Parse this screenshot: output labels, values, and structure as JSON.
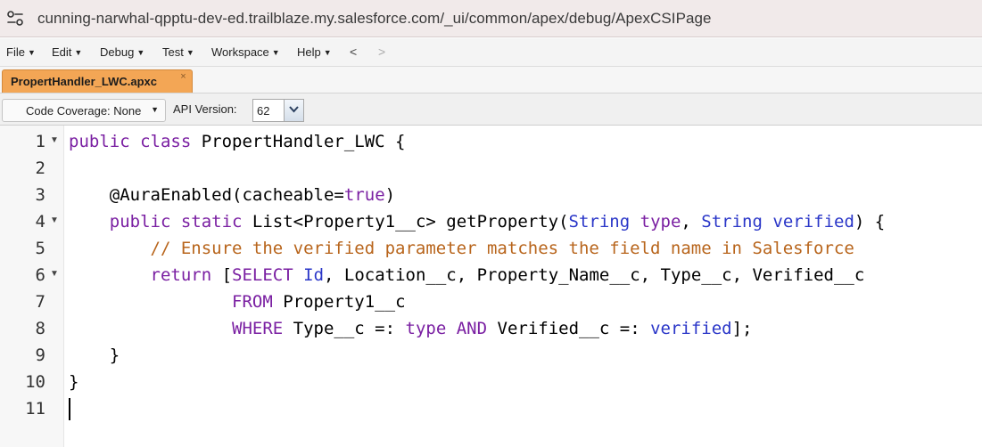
{
  "browser": {
    "url": "cunning-narwhal-qpptu-dev-ed.trailblaze.my.salesforce.com/_ui/common/apex/debug/ApexCSIPage"
  },
  "menu": {
    "file": "File",
    "edit": "Edit",
    "debug": "Debug",
    "test": "Test",
    "workspace": "Workspace",
    "help": "Help",
    "back": "<",
    "forward": ">"
  },
  "tab": {
    "label": "PropertHandler_LWC.apxc",
    "close": "×"
  },
  "toolbar": {
    "coverage_label": "Code Coverage: None",
    "api_label": "API Version:",
    "api_value": "62"
  },
  "editor": {
    "line_numbers": [
      "1",
      "2",
      "3",
      "4",
      "5",
      "6",
      "7",
      "8",
      "9",
      "10",
      "11"
    ],
    "lines": [
      [
        {
          "t": "public class",
          "c": "k"
        },
        {
          "t": " PropertHandler_LWC {",
          "c": ""
        }
      ],
      [],
      [
        {
          "t": "    @AuraEnabled",
          "c": ""
        },
        {
          "t": "(cacheable=",
          "c": ""
        },
        {
          "t": "true",
          "c": "k"
        },
        {
          "t": ")",
          "c": ""
        }
      ],
      [
        {
          "t": "    ",
          "c": ""
        },
        {
          "t": "public static",
          "c": "k"
        },
        {
          "t": " List<Property1__c> getProperty(",
          "c": ""
        },
        {
          "t": "String",
          "c": "t"
        },
        {
          "t": " ",
          "c": ""
        },
        {
          "t": "type",
          "c": "k"
        },
        {
          "t": ", ",
          "c": ""
        },
        {
          "t": "String",
          "c": "t"
        },
        {
          "t": " ",
          "c": ""
        },
        {
          "t": "verified",
          "c": "t"
        },
        {
          "t": ") {",
          "c": ""
        }
      ],
      [
        {
          "t": "        // Ensure the verified parameter matches the field name in Salesforce",
          "c": "c"
        }
      ],
      [
        {
          "t": "        ",
          "c": ""
        },
        {
          "t": "return",
          "c": "k"
        },
        {
          "t": " [",
          "c": ""
        },
        {
          "t": "SELECT",
          "c": "k"
        },
        {
          "t": " ",
          "c": ""
        },
        {
          "t": "Id",
          "c": "t"
        },
        {
          "t": ", Location__c, Property_Name__c, Type__c, Verified__c",
          "c": ""
        }
      ],
      [
        {
          "t": "                ",
          "c": ""
        },
        {
          "t": "FROM",
          "c": "k"
        },
        {
          "t": " Property1__c",
          "c": ""
        }
      ],
      [
        {
          "t": "                ",
          "c": ""
        },
        {
          "t": "WHERE",
          "c": "k"
        },
        {
          "t": " Type__c =: ",
          "c": ""
        },
        {
          "t": "type",
          "c": "k"
        },
        {
          "t": " ",
          "c": ""
        },
        {
          "t": "AND",
          "c": "k"
        },
        {
          "t": " Verified__c =: ",
          "c": ""
        },
        {
          "t": "verified",
          "c": "t"
        },
        {
          "t": "];",
          "c": ""
        }
      ],
      [
        {
          "t": "    }",
          "c": ""
        }
      ],
      [
        {
          "t": "}",
          "c": ""
        }
      ],
      []
    ],
    "fold_lines": [
      1,
      4,
      6
    ]
  }
}
